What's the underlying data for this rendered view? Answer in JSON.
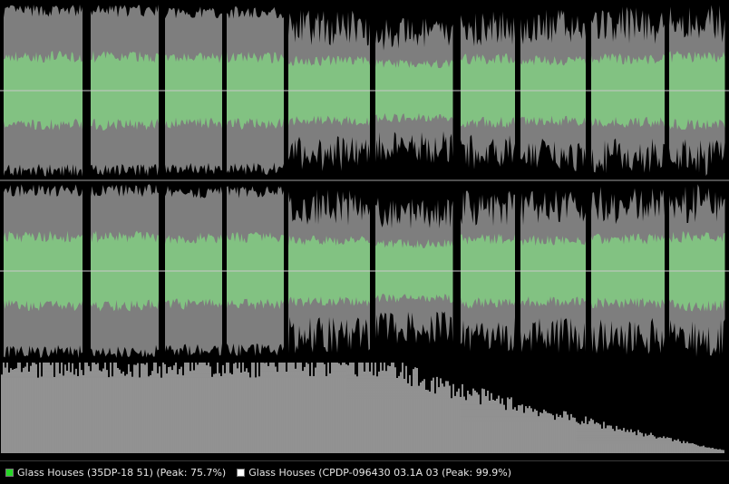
{
  "colors": {
    "background": "#000000",
    "wave_gray": "#7e7e7e",
    "wave_green": "#82c282",
    "spectrum": "#cfcfcf",
    "center_line": "#c8c8c8",
    "divider": "#a0a0a0"
  },
  "legend": [
    {
      "label": "Glass Houses (35DP-18 51) (Peak: 75.7%)",
      "color": "#26d626"
    },
    {
      "label": "Glass Houses (CPDP-096430 03.1A 03 (Peak: 99.9%)",
      "color": "#ffffff"
    }
  ],
  "tracks": {
    "count": 11,
    "gray_amplitude": [
      0.97,
      0.97,
      0.95,
      0.95,
      0.92,
      0.82,
      0.9,
      0.92,
      0.95,
      0.97,
      0.55
    ],
    "green_amplitude": [
      0.45,
      0.45,
      0.43,
      0.44,
      0.4,
      0.36,
      0.42,
      0.4,
      0.42,
      0.45,
      0.22
    ]
  }
}
